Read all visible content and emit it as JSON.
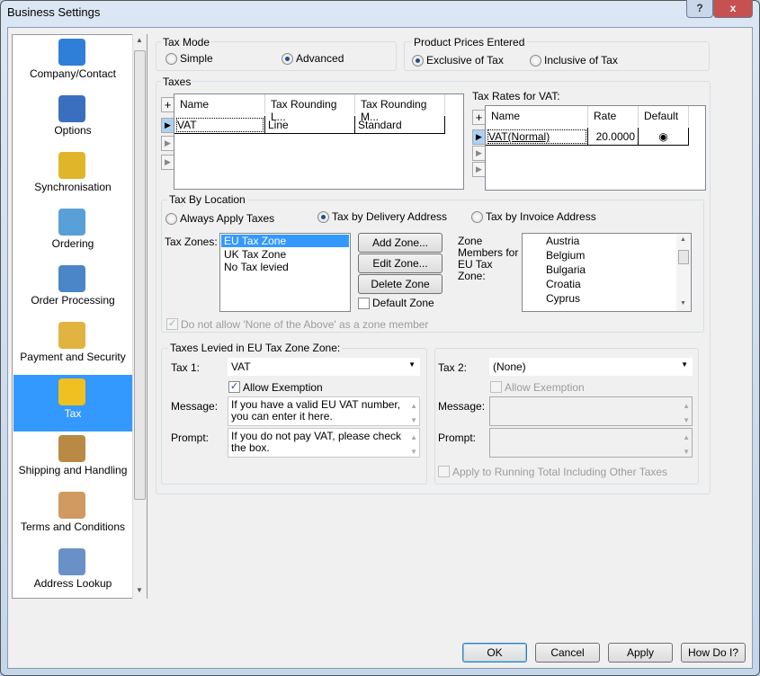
{
  "window": {
    "title": "Business Settings",
    "help": "?",
    "close": "x"
  },
  "sidebar": {
    "items": [
      {
        "label": "Company/Contact",
        "icon": "building-icon",
        "color": "#2f7fd8"
      },
      {
        "label": "Options",
        "icon": "gears-icon",
        "color": "#3a6fc0"
      },
      {
        "label": "Synchronisation",
        "icon": "database-sync-icon",
        "color": "#e0b52a"
      },
      {
        "label": "Ordering",
        "icon": "shopping-cart-icon",
        "color": "#5aa0d8"
      },
      {
        "label": "Order Processing",
        "icon": "form-icon",
        "color": "#4a86c8"
      },
      {
        "label": "Payment and Security",
        "icon": "credit-card-icon",
        "color": "#e2b340"
      },
      {
        "label": "Tax",
        "icon": "coins-icon",
        "color": "#f0c020"
      },
      {
        "label": "Shipping and Handling",
        "icon": "package-icon",
        "color": "#b88a44"
      },
      {
        "label": "Terms and Conditions",
        "icon": "handshake-icon",
        "color": "#d09a60"
      },
      {
        "label": "Address Lookup",
        "icon": "address-card-icon",
        "color": "#6a90c8"
      }
    ],
    "selected": "Tax"
  },
  "tax_mode": {
    "label": "Tax Mode",
    "options": [
      "Simple",
      "Advanced"
    ],
    "selected": "Advanced"
  },
  "prices": {
    "label": "Product Prices Entered",
    "options": [
      "Exclusive of Tax",
      "Inclusive of Tax"
    ],
    "selected": "Exclusive of Tax"
  },
  "taxes": {
    "label": "Taxes",
    "columns": [
      "Name",
      "Tax Rounding L...",
      "Tax Rounding M..."
    ],
    "rows": [
      [
        "VAT",
        "Line",
        "Standard"
      ]
    ]
  },
  "rates": {
    "label": "Tax Rates for VAT:",
    "columns": [
      "Name",
      "Rate",
      "Default"
    ],
    "rows": [
      [
        "VAT(Normal)",
        "20.0000"
      ]
    ]
  },
  "location": {
    "label": "Tax By Location",
    "options": [
      "Always Apply Taxes",
      "Tax by Delivery Address",
      "Tax by Invoice Address"
    ],
    "selected": "Tax by Delivery Address",
    "zones_label": "Tax Zones:",
    "zones": [
      "EU Tax Zone",
      "UK Tax Zone",
      "No Tax levied"
    ],
    "selected_zone": "EU Tax Zone",
    "add": "Add Zone...",
    "edit": "Edit Zone...",
    "delete": "Delete Zone",
    "default_zone": "Default Zone",
    "members_label": "Zone Members for EU Tax Zone:",
    "members": [
      "Austria",
      "Belgium",
      "Bulgaria",
      "Croatia",
      "Cyprus"
    ],
    "none_above": "Do not allow 'None of the Above' as a zone member"
  },
  "levied": {
    "label": "Taxes Levied in EU Tax Zone Zone:",
    "tax1_label": "Tax 1:",
    "tax1": "VAT",
    "allow1": "Allow Exemption",
    "allow1_checked": true,
    "message_label": "Message:",
    "message1": "If you have a valid EU VAT number, you can enter it here.",
    "prompt_label": "Prompt:",
    "prompt1": "If you do not pay VAT, please check the box.",
    "tax2_label": "Tax 2:",
    "tax2": "(None)",
    "allow2": "Allow Exemption",
    "running": "Apply to Running Total Including Other Taxes"
  },
  "buttons": {
    "ok": "OK",
    "cancel": "Cancel",
    "apply": "Apply",
    "how": "How Do I?"
  }
}
